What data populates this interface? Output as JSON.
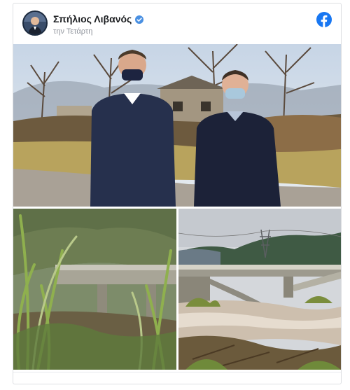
{
  "post": {
    "author": "Σπήλιος Λιβανός",
    "time": "την Τετάρτη",
    "verified": true
  },
  "icons": {
    "verified": "verified-badge-icon",
    "network": "facebook-logo-icon"
  },
  "colors": {
    "brand_blue": "#1877f2",
    "author_text": "#1c1e21",
    "meta_text": "#90949c",
    "border": "#dddfe2"
  },
  "photos": [
    {
      "id": "main",
      "subject": "two-men-with-face-masks-by-flooded-river"
    },
    {
      "id": "left",
      "subject": "damaged-bridge-behind-reeds"
    },
    {
      "id": "right",
      "subject": "collapsed-bridge-over-muddy-river"
    }
  ]
}
